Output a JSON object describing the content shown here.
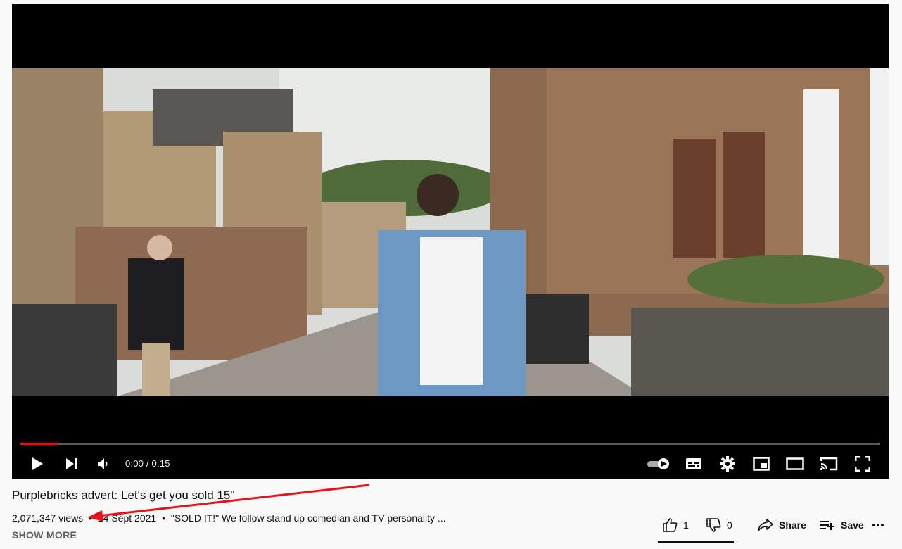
{
  "player": {
    "time_display": "0:00 / 0:15",
    "progress_played_fraction": 0.043,
    "colors": {
      "progress": "#ff0000",
      "background": "#000000"
    }
  },
  "controls": {
    "left": [
      "play-icon",
      "next-icon",
      "volume-icon"
    ],
    "right": [
      "autoplay-toggle-icon",
      "subtitles-icon",
      "settings-gear-icon",
      "miniplayer-icon",
      "theater-mode-icon",
      "cast-icon",
      "fullscreen-icon"
    ]
  },
  "video": {
    "title": "Purplebricks advert: Let's get you sold 15\"",
    "views": "2,071,347 views",
    "separator": "•",
    "date": "24 Sept 2021",
    "description_snippet": "\"SOLD IT!\" We follow stand up comedian and TV personality ...",
    "show_more": "SHOW MORE"
  },
  "actions": {
    "like_count": "1",
    "dislike_count": "0",
    "share_label": "Share",
    "save_label": "Save"
  },
  "annotation": {
    "color": "#e8141c"
  }
}
